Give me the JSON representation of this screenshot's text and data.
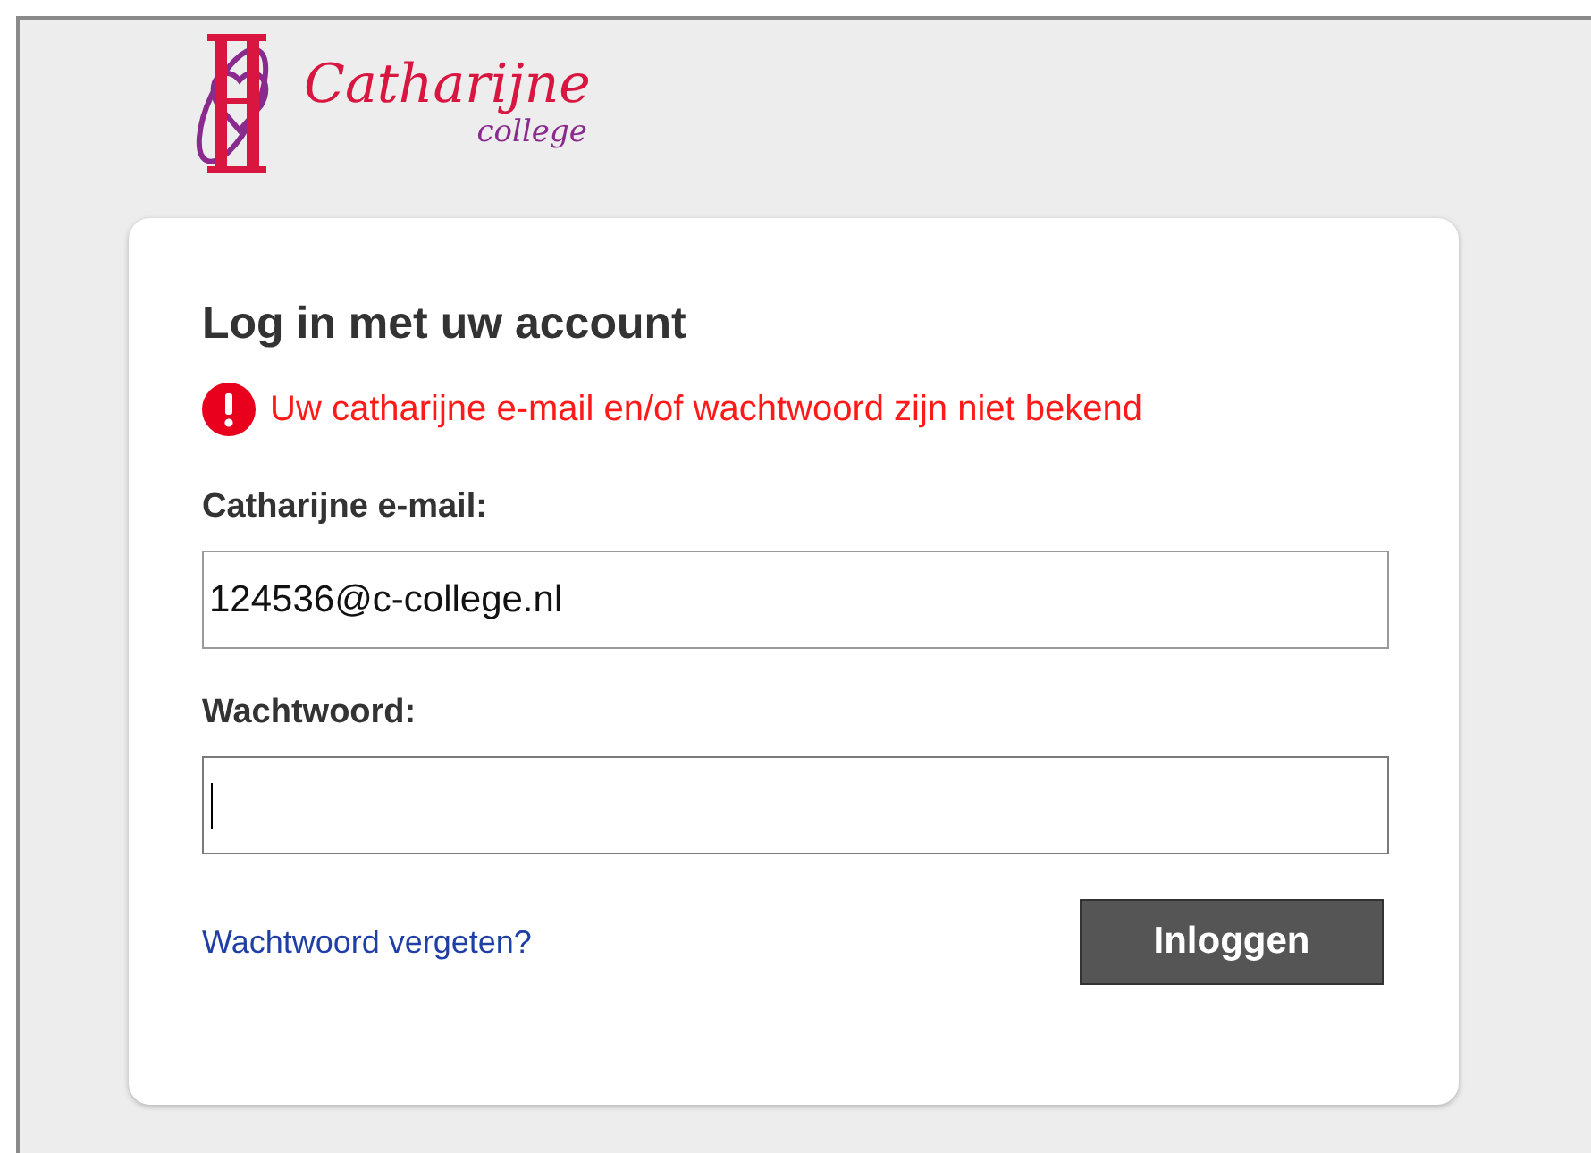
{
  "logo": {
    "name": "Catharijne",
    "subtitle": "college"
  },
  "login": {
    "title": "Log in met uw account",
    "error": "Uw catharijne e-mail en/of wachtwoord zijn niet bekend",
    "fields": [
      {
        "label": "Catharijne e-mail:",
        "value": "124536@c-college.nl",
        "focused": false
      },
      {
        "label": "Wachtwoord:",
        "focused": true
      }
    ],
    "forgot_link": "Wachtwoord vergeten?",
    "submit_button": "Inloggen"
  }
}
